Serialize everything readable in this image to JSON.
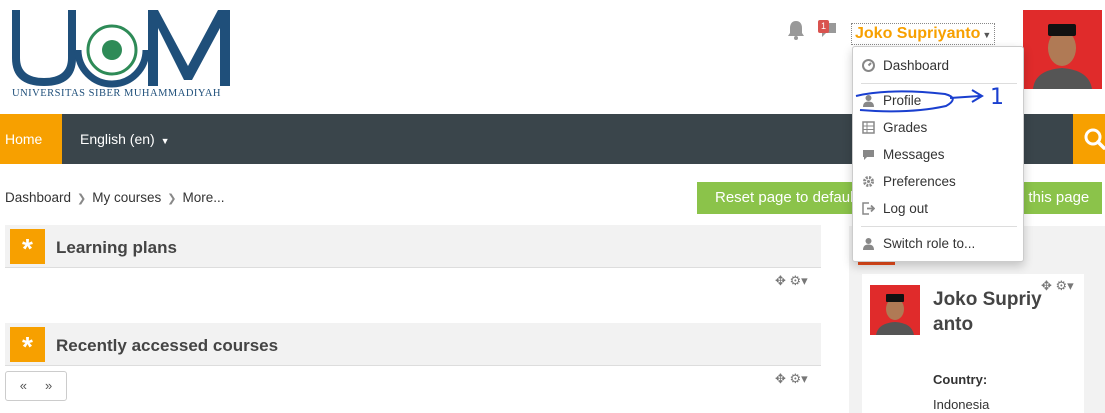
{
  "logo": {
    "letters": "UCM",
    "subtitle": "UNIVERSITAS SIBER MUHAMMADIYAH"
  },
  "header": {
    "username": "Joko Supriyanto",
    "message_count": "1"
  },
  "navbar": {
    "home": "Home",
    "language": "English (en)"
  },
  "breadcrumb": [
    "Dashboard",
    "My courses",
    "More..."
  ],
  "buttons": {
    "reset": "Reset page to default",
    "stop_customising": "Stop customising this page"
  },
  "blocks": {
    "learning_plans": "Learning plans",
    "recent_courses": "Recently accessed courses",
    "pager_prev": "«",
    "pager_next": "»"
  },
  "profile": {
    "name": "Joko Supriyanto",
    "country_label": "Country:",
    "country": "Indonesia"
  },
  "user_menu": {
    "items": [
      {
        "label": "Dashboard",
        "icon": "dashboard-icon"
      },
      {
        "label": "Profile",
        "icon": "user-icon"
      },
      {
        "label": "Grades",
        "icon": "grades-icon"
      },
      {
        "label": "Messages",
        "icon": "messages-icon"
      },
      {
        "label": "Preferences",
        "icon": "gear-icon"
      },
      {
        "label": "Log out",
        "icon": "logout-icon"
      },
      {
        "label": "Switch role to...",
        "icon": "user-icon"
      }
    ]
  },
  "annotation": {
    "text": "1"
  },
  "colors": {
    "accent": "#f7a000",
    "navbar": "#3a454b",
    "green": "#8bc34a",
    "annotation": "#1a3fcf"
  }
}
